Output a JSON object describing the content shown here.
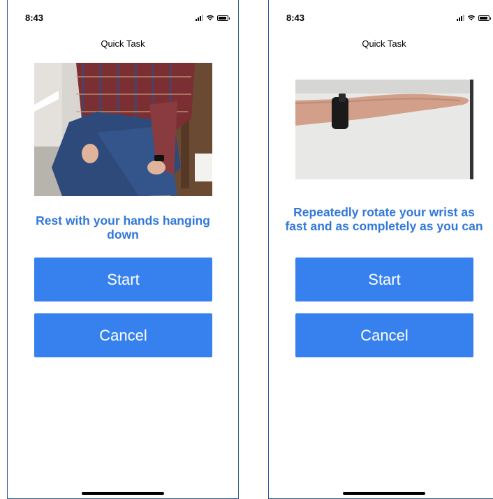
{
  "screens": [
    {
      "status": {
        "time": "8:43",
        "icons": [
          "signal-icon",
          "wifi-icon",
          "battery-icon"
        ]
      },
      "nav_title": "Quick Task",
      "image": "person seated in a chair with hands hanging down at sides",
      "instruction": "Rest with your hands hanging down",
      "start_label": "Start",
      "cancel_label": "Cancel"
    },
    {
      "status": {
        "time": "8:43",
        "icons": [
          "signal-icon",
          "wifi-icon",
          "battery-icon"
        ]
      },
      "nav_title": "Quick Task",
      "image": "forearm extended horizontally with smartwatch on wrist",
      "instruction": "Repeatedly rotate your wrist as fast and as completely as you can",
      "start_label": "Start",
      "cancel_label": "Cancel"
    }
  ],
  "colors": {
    "accent": "#3781ef",
    "instruction_text": "#3278d8",
    "frame_border": "#2e5b8f"
  }
}
